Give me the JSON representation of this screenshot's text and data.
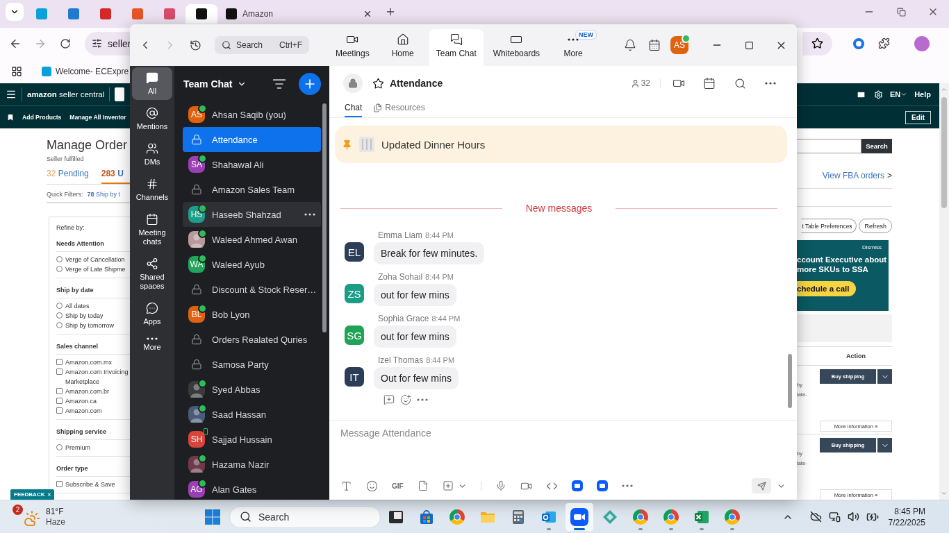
{
  "browser": {
    "tabs": [
      {
        "color": "#0aa0d8",
        "selected": false
      },
      {
        "color": "#1f7ad1",
        "selected": false
      },
      {
        "color": "#d42828",
        "selected": false
      },
      {
        "color": "#e8542a",
        "selected": false
      },
      {
        "color": "#d84b6b",
        "selected": false
      },
      {
        "color": "#111111",
        "selected": true
      },
      {
        "title": "Amazon",
        "color": "#111111",
        "selected": false
      }
    ],
    "address": "seller",
    "bookmarks": [
      {
        "color": "#0aa0d8",
        "title": "Welcome- ECExpre"
      }
    ]
  },
  "seller": {
    "logo": "**amazon** seller central",
    "nav": [
      "Add Products",
      "Manage All Inventor"
    ],
    "lang": "EN",
    "help": "Help",
    "edit": "Edit",
    "title": "Manage Order",
    "subtitle": "Seller fulfilled",
    "status_tabs": [
      {
        "count": "32",
        "label": "Pending",
        "selected": false
      },
      {
        "count": "283",
        "label": "U",
        "selected": true
      }
    ],
    "quick_filters": {
      "label": "Quick Filters:",
      "count": "78",
      "text": "Ship by t"
    },
    "refine": {
      "title": "Refine by:",
      "groups": [
        {
          "title": "Needs Attention",
          "options": [
            {
              "kind": "radio",
              "label": "Verge of Cancellation",
              "checked": false
            },
            {
              "kind": "radio",
              "label": "Verge of Late Shipme",
              "checked": false
            }
          ]
        },
        {
          "title": "Ship by date",
          "options": [
            {
              "kind": "radio",
              "label": "All dates",
              "checked": false
            },
            {
              "kind": "radio",
              "label": "Ship by today",
              "checked": false
            },
            {
              "kind": "radio",
              "label": "Ship by tomorrow",
              "checked": false
            }
          ]
        },
        {
          "title": "Sales channel",
          "options": [
            {
              "kind": "checkbox",
              "label": "Amazon.com.mx",
              "checked": false
            },
            {
              "kind": "checkbox",
              "label": "Amazon.com Invoicing Marketplace",
              "checked": false
            },
            {
              "kind": "checkbox",
              "label": "Amazon.com.br",
              "checked": false
            },
            {
              "kind": "checkbox",
              "label": "Amazon.ca",
              "checked": false
            },
            {
              "kind": "checkbox",
              "label": "Amazon.com",
              "checked": false
            }
          ]
        },
        {
          "title": "Shipping service",
          "options": [
            {
              "kind": "radio",
              "label": "Premium",
              "checked": false
            }
          ]
        },
        {
          "title": "Order type",
          "options": [
            {
              "kind": "checkbox",
              "label": "Subscribe & Save",
              "checked": false
            }
          ]
        }
      ]
    },
    "search_button": "Search",
    "fba_link": "View FBA orders",
    "fba_chevron": ">",
    "table_buttons": [
      "t Table Preferences",
      "Refresh"
    ],
    "promo": {
      "dismiss": "Dismiss",
      "lines": [
        "ccount Executive about",
        "more SKUs to SSA"
      ],
      "cta": "chedule a call"
    },
    "table": {
      "header": "Action",
      "rows": [
        {
          "notes": [
            "by",
            "late-"
          ],
          "button": "Buy shipping",
          "more": "More information ≡"
        },
        {
          "notes": [
            "by",
            "late-"
          ],
          "button": "Buy shipping",
          "more": "More information ≡"
        }
      ]
    },
    "feedback": "FEEDBACK",
    "feedback_close": "×"
  },
  "zoom": {
    "search": {
      "placeholder": "Search",
      "shortcut": "Ctrl+F"
    },
    "tabs": [
      {
        "kind": "meetings",
        "label": "Meetings",
        "selected": false
      },
      {
        "kind": "home",
        "label": "Home",
        "selected": false
      },
      {
        "kind": "chat",
        "label": "Team Chat",
        "selected": true
      },
      {
        "kind": "whiteboards",
        "label": "Whiteboards",
        "selected": false
      },
      {
        "kind": "more",
        "label": "More",
        "badge": "NEW",
        "selected": false
      }
    ],
    "avatar": {
      "initials": "AS",
      "color": "#e0610e"
    },
    "rail": [
      {
        "kind": "all",
        "label": "All",
        "selected": true
      },
      {
        "kind": "mentions",
        "label": "Mentions",
        "selected": false
      },
      {
        "kind": "dms",
        "label": "DMs",
        "selected": false
      },
      {
        "kind": "channels",
        "label": "Channels",
        "selected": false
      },
      {
        "kind": "meetings",
        "label": "Meeting chats",
        "selected": false
      },
      {
        "kind": "shared",
        "label": "Shared spaces",
        "selected": false
      },
      {
        "kind": "apps",
        "label": "Apps",
        "selected": false
      },
      {
        "kind": "more",
        "label": "More",
        "selected": false
      }
    ],
    "list_title": "Team Chat",
    "chats": [
      {
        "kind": "person",
        "name": "Ahsan Saqib (you)",
        "initials": "AS",
        "color": "#e0610e",
        "online": true,
        "mobile": false,
        "selected": false,
        "hovered": false
      },
      {
        "kind": "channel",
        "name": "Attendance",
        "online": false,
        "mobile": false,
        "selected": true,
        "hovered": false
      },
      {
        "kind": "person",
        "name": "Shahawal Ali",
        "initials": "SA",
        "color": "#9b3fb5",
        "online": true,
        "mobile": false,
        "selected": false,
        "hovered": false
      },
      {
        "kind": "channel",
        "name": "Amazon Sales Team",
        "online": false,
        "mobile": false,
        "selected": false,
        "hovered": false
      },
      {
        "kind": "person",
        "name": "Haseeb Shahzad",
        "initials": "HS",
        "color": "#1b9e8a",
        "online": true,
        "mobile": false,
        "selected": false,
        "hovered": true
      },
      {
        "kind": "photo",
        "name": "Waleed Ahmed Awan",
        "color": "#b89a9a",
        "online": true,
        "mobile": false,
        "selected": false,
        "hovered": false
      },
      {
        "kind": "person",
        "name": "Waleed Ayub",
        "initials": "WA",
        "color": "#22a55b",
        "online": true,
        "mobile": false,
        "selected": false,
        "hovered": false
      },
      {
        "kind": "channel",
        "name": "Discount & Stock Reser…",
        "online": false,
        "mobile": false,
        "selected": false,
        "hovered": false
      },
      {
        "kind": "person",
        "name": "Bob Lyon",
        "initials": "BL",
        "color": "#e0610e",
        "online": true,
        "mobile": false,
        "selected": false,
        "hovered": false
      },
      {
        "kind": "channel",
        "name": "Orders Realated Quries",
        "online": false,
        "mobile": false,
        "selected": false,
        "hovered": false
      },
      {
        "kind": "channel",
        "name": "Samosa Party",
        "online": false,
        "mobile": false,
        "selected": false,
        "hovered": false
      },
      {
        "kind": "photo",
        "name": "Syed Abbas",
        "color": "#3a3a3a",
        "online": true,
        "mobile": false,
        "selected": false,
        "hovered": false
      },
      {
        "kind": "photo",
        "name": "Saad Hassan",
        "color": "#4a5a78",
        "online": true,
        "mobile": false,
        "selected": false,
        "hovered": false
      },
      {
        "kind": "person",
        "name": "Sajjad Hussain",
        "initials": "SH",
        "color": "#d9453b",
        "online": false,
        "mobile": true,
        "selected": false,
        "hovered": false
      },
      {
        "kind": "photo",
        "name": "Hazama Nazir",
        "color": "#6e3a4a",
        "online": true,
        "mobile": false,
        "selected": false,
        "hovered": false
      },
      {
        "kind": "person",
        "name": "Alan Gates",
        "initials": "AG",
        "color": "#9b3fb5",
        "online": true,
        "mobile": false,
        "selected": false,
        "hovered": false
      }
    ],
    "channel": {
      "name": "Attendance",
      "members": "32",
      "tabs": [
        {
          "kind": "chat",
          "label": "Chat",
          "selected": true
        },
        {
          "kind": "resources",
          "label": "Resources",
          "selected": false
        }
      ],
      "pinned": "Updated Dinner Hours",
      "divider": "New messages",
      "messages": [
        {
          "sender": "Emma Liam",
          "time": "8:44 PM",
          "text": "Break for few minutes.",
          "initials": "EL",
          "color": "#2c3e57"
        },
        {
          "sender": "Zoha Sohail",
          "time": "8:44 PM",
          "text": "out for few mins",
          "initials": "ZS",
          "color": "#1a9c85"
        },
        {
          "sender": "Sophia Grace",
          "time": "8:44 PM",
          "text": "out for few mins",
          "initials": "SG",
          "color": "#21a355"
        },
        {
          "sender": "Izel Thomas",
          "time": "8:44 PM",
          "text": "Out for few mins",
          "initials": "IT",
          "color": "#2c3e57"
        }
      ],
      "composer_placeholder": "Message Attendance",
      "gif": "GIF"
    }
  },
  "taskbar": {
    "weather": {
      "temp": "81°F",
      "condition": "Haze",
      "badge": "2"
    },
    "search": "Search",
    "apps": [
      {
        "kind": "terminal",
        "running": false,
        "selected": false
      },
      {
        "kind": "store",
        "running": false,
        "selected": false
      },
      {
        "kind": "chrome",
        "running": false,
        "selected": false
      },
      {
        "kind": "folder",
        "running": false,
        "selected": false
      },
      {
        "kind": "calculator",
        "running": false,
        "selected": false
      },
      {
        "kind": "outlook",
        "running": true,
        "selected": false
      },
      {
        "kind": "zoom",
        "running": true,
        "selected": true
      },
      {
        "kind": "diamond",
        "running": false,
        "selected": false
      },
      {
        "kind": "chrome",
        "running": true,
        "selected": false
      },
      {
        "kind": "chrome",
        "running": true,
        "selected": false
      },
      {
        "kind": "excel",
        "running": true,
        "selected": false
      },
      {
        "kind": "chrome",
        "running": true,
        "selected": false
      }
    ],
    "time": "8:45 PM",
    "date": "7/22/2025"
  }
}
